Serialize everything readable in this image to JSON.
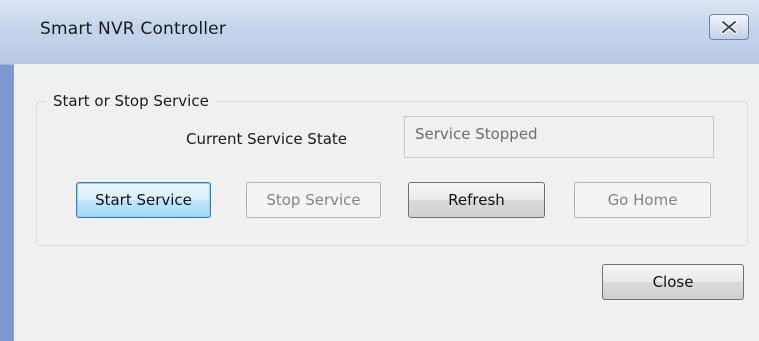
{
  "window": {
    "title": "Smart NVR Controller",
    "close_icon": "close-x-icon"
  },
  "group": {
    "legend": "Start or Stop Service",
    "state_label": "Current Service State",
    "state_value": "Service Stopped"
  },
  "buttons": {
    "start": "Start Service",
    "stop": "Stop Service",
    "refresh": "Refresh",
    "home": "Go Home",
    "close": "Close"
  },
  "colors": {
    "titlebar": "#c4d4ea",
    "client_bg": "#f0f0f0",
    "focus_border": "#3c7fb1",
    "disabled_text": "#838383"
  }
}
